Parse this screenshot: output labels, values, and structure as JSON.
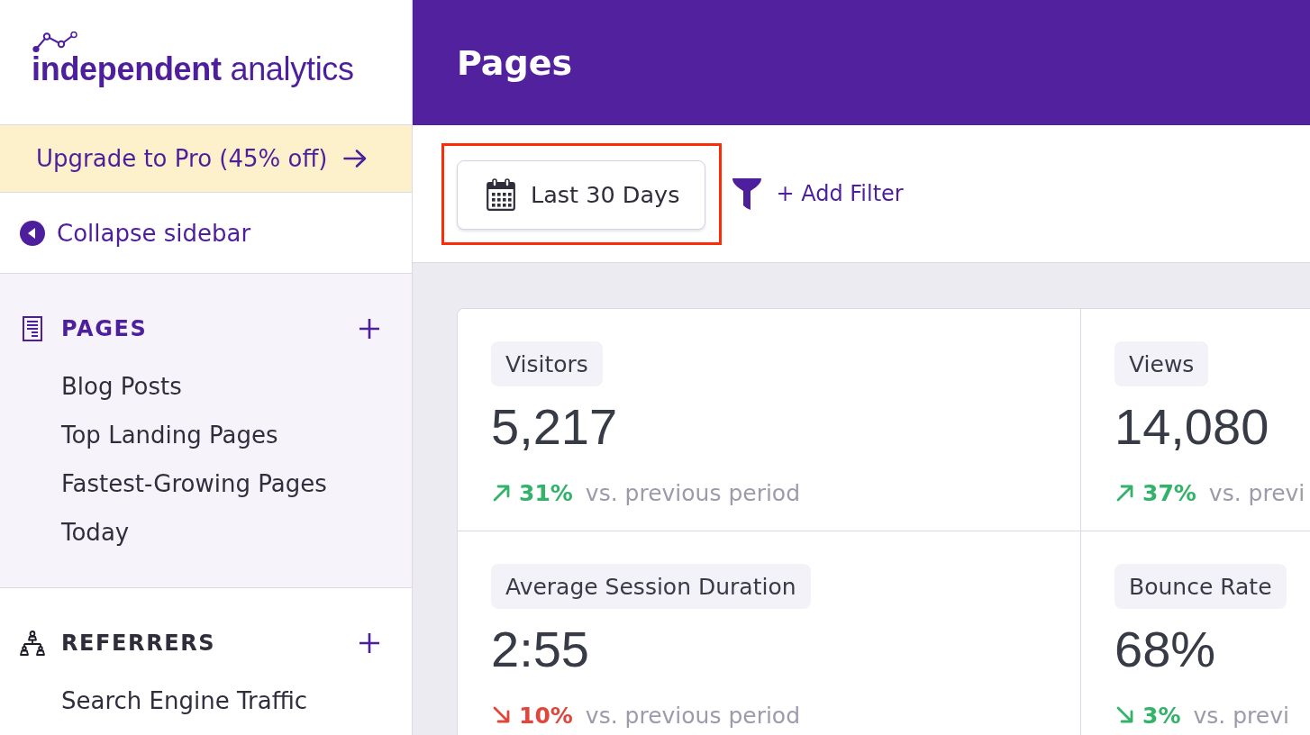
{
  "sidebar": {
    "logo": "**independent** analytics",
    "upgrade_banner": "Upgrade to Pro (45% off)",
    "collapse": "Collapse sidebar",
    "sections": [
      {
        "kind": "pages",
        "title": "PAGES",
        "selected": true,
        "items": [
          "Blog Posts",
          "Top Landing Pages",
          "Fastest-Growing Pages",
          "Today"
        ]
      },
      {
        "kind": "referrers",
        "title": "REFERRERS",
        "selected": false,
        "items": [
          "Search Engine Traffic"
        ]
      }
    ]
  },
  "header": {
    "title": "Pages"
  },
  "toolbar": {
    "date_range": {
      "label": "Last 30 Days",
      "highlighted": true
    },
    "add_filter": "+ Add Filter"
  },
  "metrics": [
    {
      "label": "Visitors",
      "value": "5,217",
      "increase": true,
      "positive": true,
      "change": "31%",
      "comparison": "vs. previous period"
    },
    {
      "label": "Views",
      "value": "14,080",
      "increase": true,
      "positive": true,
      "change": "37%",
      "comparison": "vs. previ"
    },
    {
      "label": "Average Session Duration",
      "value": "2:55",
      "increase": false,
      "positive": false,
      "change": "10%",
      "comparison": "vs. previous period"
    },
    {
      "label": "Bounce Rate",
      "value": "68%",
      "increase": false,
      "positive": true,
      "change": "3%",
      "comparison": "vs. previ"
    }
  ]
}
